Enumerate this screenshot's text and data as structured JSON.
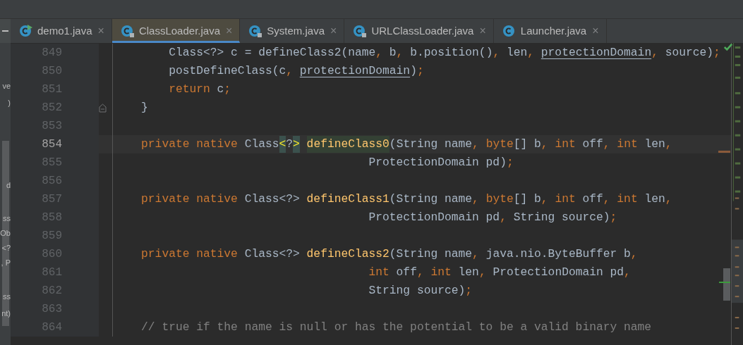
{
  "side_panel": {
    "fragments": [
      "ve",
      ")",
      "d",
      "ss",
      "Ob",
      "<?",
      ", P",
      "ss",
      "nt)"
    ]
  },
  "tabs": [
    {
      "label": "demo1.java",
      "selected": false,
      "locked": false,
      "runnable": true,
      "close": "×"
    },
    {
      "label": "ClassLoader.java",
      "selected": true,
      "locked": true,
      "runnable": false,
      "close": "×"
    },
    {
      "label": "System.java",
      "selected": false,
      "locked": true,
      "runnable": false,
      "close": "×"
    },
    {
      "label": "URLClassLoader.java",
      "selected": false,
      "locked": true,
      "runnable": false,
      "close": "×"
    },
    {
      "label": "Launcher.java",
      "selected": false,
      "locked": false,
      "runnable": false,
      "close": "×"
    }
  ],
  "editor": {
    "lines": [
      {
        "number": "849",
        "current": false,
        "fold": false,
        "tokens": [
          {
            "kind": "text",
            "text": "        Class<?> c = defineClass2(name"
          },
          {
            "kind": "punct",
            "text": ","
          },
          {
            "kind": "text",
            "text": " b"
          },
          {
            "kind": "punct",
            "text": ","
          },
          {
            "kind": "text",
            "text": " b.position()"
          },
          {
            "kind": "punct",
            "text": ","
          },
          {
            "kind": "text",
            "text": " len"
          },
          {
            "kind": "punct",
            "text": ", "
          },
          {
            "kind": "field",
            "text": "protectionDomain"
          },
          {
            "kind": "punct",
            "text": ","
          },
          {
            "kind": "text",
            "text": " source)"
          },
          {
            "kind": "punct",
            "text": ";"
          }
        ]
      },
      {
        "number": "850",
        "current": false,
        "fold": false,
        "tokens": [
          {
            "kind": "text",
            "text": "        postDefineClass(c"
          },
          {
            "kind": "punct",
            "text": ", "
          },
          {
            "kind": "field",
            "text": "protectionDomain"
          },
          {
            "kind": "text",
            "text": ")"
          },
          {
            "kind": "punct",
            "text": ";"
          }
        ]
      },
      {
        "number": "851",
        "current": false,
        "fold": false,
        "tokens": [
          {
            "kind": "kw",
            "text": "        return"
          },
          {
            "kind": "text",
            "text": " c"
          },
          {
            "kind": "punct",
            "text": ";"
          }
        ]
      },
      {
        "number": "852",
        "current": false,
        "fold": true,
        "tokens": [
          {
            "kind": "text",
            "text": "    }"
          }
        ]
      },
      {
        "number": "853",
        "current": false,
        "fold": false
      },
      {
        "number": "854",
        "current": true,
        "fold": false,
        "tokens": [
          {
            "kind": "kw",
            "text": "    private native"
          },
          {
            "kind": "text",
            "text": " Class"
          },
          {
            "kind": "match",
            "text": "<"
          },
          {
            "kind": "text",
            "text": "?"
          },
          {
            "kind": "match",
            "text": ">"
          },
          {
            "kind": "fn_hl",
            "text": "defineClass0",
            "spaced": true
          },
          {
            "kind": "text",
            "text": "(String name"
          },
          {
            "kind": "punct",
            "text": ","
          },
          {
            "kind": "kw",
            "text": " byte"
          },
          {
            "kind": "text",
            "text": "[] b"
          },
          {
            "kind": "punct",
            "text": ","
          },
          {
            "kind": "kw",
            "text": " int"
          },
          {
            "kind": "text",
            "text": " off"
          },
          {
            "kind": "punct",
            "text": ","
          },
          {
            "kind": "kw",
            "text": " int"
          },
          {
            "kind": "text",
            "text": " len"
          },
          {
            "kind": "punct",
            "text": ","
          }
        ]
      },
      {
        "number": "855",
        "current": false,
        "fold": false,
        "tokens": [
          {
            "kind": "text",
            "text": "                                     ProtectionDomain pd)"
          },
          {
            "kind": "punct",
            "text": ";"
          }
        ]
      },
      {
        "number": "856",
        "current": false,
        "fold": false
      },
      {
        "number": "857",
        "current": false,
        "fold": false,
        "tokens": [
          {
            "kind": "kw",
            "text": "    private native"
          },
          {
            "kind": "text",
            "text": " Class<?> "
          },
          {
            "kind": "fn",
            "text": "defineClass1"
          },
          {
            "kind": "text",
            "text": "(String name"
          },
          {
            "kind": "punct",
            "text": ","
          },
          {
            "kind": "kw",
            "text": " byte"
          },
          {
            "kind": "text",
            "text": "[] b"
          },
          {
            "kind": "punct",
            "text": ","
          },
          {
            "kind": "kw",
            "text": " int"
          },
          {
            "kind": "text",
            "text": " off"
          },
          {
            "kind": "punct",
            "text": ","
          },
          {
            "kind": "kw",
            "text": " int"
          },
          {
            "kind": "text",
            "text": " len"
          },
          {
            "kind": "punct",
            "text": ","
          }
        ]
      },
      {
        "number": "858",
        "current": false,
        "fold": false,
        "tokens": [
          {
            "kind": "text",
            "text": "                                     ProtectionDomain pd"
          },
          {
            "kind": "punct",
            "text": ","
          },
          {
            "kind": "text",
            "text": " String source)"
          },
          {
            "kind": "punct",
            "text": ";"
          }
        ]
      },
      {
        "number": "859",
        "current": false,
        "fold": false
      },
      {
        "number": "860",
        "current": false,
        "fold": false,
        "tokens": [
          {
            "kind": "kw",
            "text": "    private native"
          },
          {
            "kind": "text",
            "text": " Class<?> "
          },
          {
            "kind": "fn",
            "text": "defineClass2"
          },
          {
            "kind": "text",
            "text": "(String name"
          },
          {
            "kind": "punct",
            "text": ","
          },
          {
            "kind": "text",
            "text": " java.nio.ByteBuffer b"
          },
          {
            "kind": "punct",
            "text": ","
          }
        ]
      },
      {
        "number": "861",
        "current": false,
        "fold": false,
        "tokens": [
          {
            "kind": "kw",
            "text": "                                     int"
          },
          {
            "kind": "text",
            "text": " off"
          },
          {
            "kind": "punct",
            "text": ","
          },
          {
            "kind": "kw",
            "text": " int"
          },
          {
            "kind": "text",
            "text": " len"
          },
          {
            "kind": "punct",
            "text": ","
          },
          {
            "kind": "text",
            "text": " ProtectionDomain pd"
          },
          {
            "kind": "punct",
            "text": ","
          }
        ]
      },
      {
        "number": "862",
        "current": false,
        "fold": false,
        "tokens": [
          {
            "kind": "text",
            "text": "                                     String source)"
          },
          {
            "kind": "punct",
            "text": ";"
          }
        ]
      },
      {
        "number": "863",
        "current": false,
        "fold": false
      },
      {
        "number": "864",
        "current": false,
        "fold": false,
        "tokens": [
          {
            "kind": "comment",
            "text": "    // true if the name is null or has the potential to be a valid binary name"
          }
        ]
      }
    ]
  }
}
